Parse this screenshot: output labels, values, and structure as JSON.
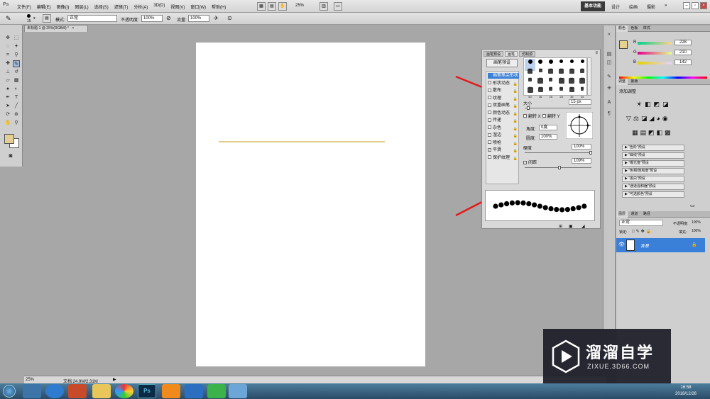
{
  "app": {
    "logo": "Ps"
  },
  "menus": [
    "文件(F)",
    "编辑(E)",
    "图像(I)",
    "图层(L)",
    "选择(S)",
    "滤镜(T)",
    "分析(A)",
    "3D(D)",
    "视图(V)",
    "窗口(W)",
    "帮助(H)"
  ],
  "zoom_top": "25%",
  "workspaces": {
    "active": "基本功能",
    "items": [
      "设计",
      "绘画",
      "摄影"
    ]
  },
  "options_bar": {
    "brush_size": "15",
    "mode_label": "模式:",
    "mode_value": "正常",
    "opacity_label": "不透明度:",
    "opacity_value": "100%",
    "flow_label": "流量:",
    "flow_value": "100%"
  },
  "document": {
    "tab_title": "未标题-1 @ 25%(RGB/8) *",
    "tab_close": "×"
  },
  "status": {
    "zoom": "25%",
    "doc_info": "文档:24.9M/2.31M"
  },
  "brushes_panel": {
    "tabs": [
      "画笔预设",
      "画笔",
      "仿制源"
    ],
    "preset_button": "画笔预设",
    "options": [
      {
        "label": "画笔笔尖形状",
        "checked": false,
        "selected": true
      },
      {
        "label": "形状动态",
        "checked": false
      },
      {
        "label": "散布",
        "checked": false
      },
      {
        "label": "纹理",
        "checked": false
      },
      {
        "label": "双重画笔",
        "checked": false
      },
      {
        "label": "颜色动态",
        "checked": false
      },
      {
        "label": "传递",
        "checked": false
      },
      {
        "label": "杂色",
        "checked": false
      },
      {
        "label": "湿边",
        "checked": false
      },
      {
        "label": "喷枪",
        "checked": false
      },
      {
        "label": "平滑",
        "checked": true
      },
      {
        "label": "保护纹理",
        "checked": false
      }
    ],
    "tip_sizes": [
      "30",
      "30",
      "30",
      "25",
      "25",
      "25",
      "36",
      "25",
      "36",
      "36",
      "36",
      "32",
      "25",
      "50",
      "25",
      "50",
      "50",
      "50",
      "50",
      "36",
      "25",
      "25",
      "35",
      "24"
    ],
    "size_label": "大小",
    "size_value": "15 px",
    "flip_x": "翻转 X",
    "flip_y": "翻转 Y",
    "angle_label": "角度:",
    "angle_value": "0度",
    "roundness_label": "圆度:",
    "roundness_value": "100%",
    "hardness_label": "硬度",
    "hardness_value": "100%",
    "spacing_label": "间距",
    "spacing_checked": true,
    "spacing_value": "109%"
  },
  "color_panel": {
    "tabs": [
      "颜色",
      "色板",
      "样式"
    ],
    "r_label": "R",
    "r_value": "228",
    "g_label": "G",
    "g_value": "210",
    "b_label": "B",
    "b_value": "142",
    "fg_color": "#e4d28e"
  },
  "adjustments_panel": {
    "tabs": [
      "调整",
      "蒙版"
    ],
    "title": "添加调整",
    "presets": [
      "\"色阶\"预设",
      "\"曲线\"预设",
      "\"曝光度\"预设",
      "\"色相/饱和度\"预设",
      "\"黑白\"预设",
      "\"通道混和器\"预设",
      "\"可选颜色\"预设"
    ]
  },
  "layers_panel": {
    "tabs": [
      "图层",
      "通道",
      "路径"
    ],
    "blend_mode": "正常",
    "opacity_label": "不透明度:",
    "opacity_value": "100%",
    "lock_label": "锁定:",
    "fill_label": "填充:",
    "fill_value": "100%",
    "layer_name": "背景"
  },
  "watermark": {
    "title": "溜溜自学",
    "subtitle": "ZIXUE.3D66.COM"
  },
  "taskbar": {
    "time": "16:58",
    "date": "2018/12/26"
  }
}
